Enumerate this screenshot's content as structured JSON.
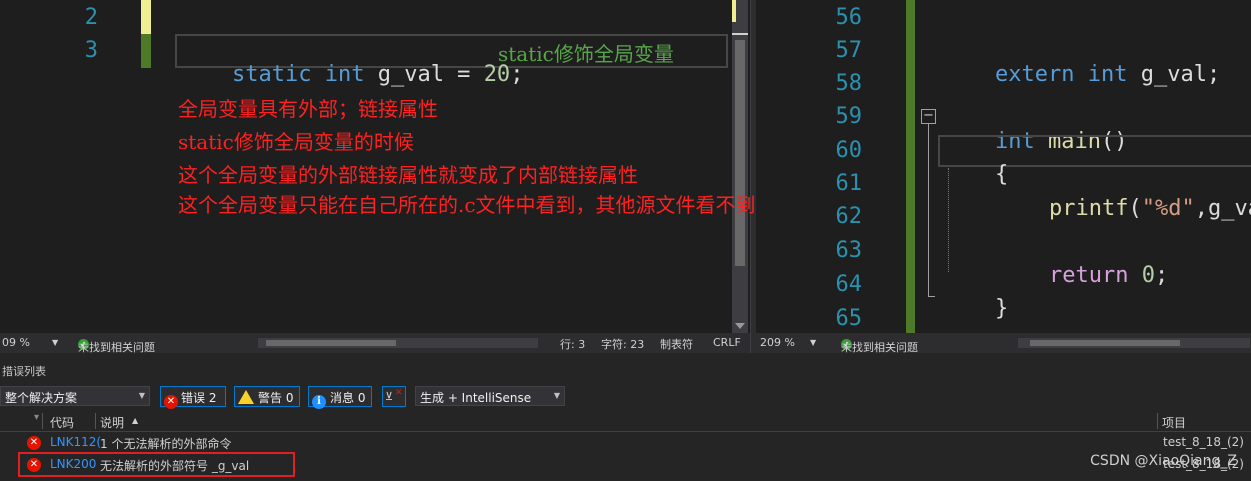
{
  "left_editor": {
    "line_numbers": [
      "2",
      "3"
    ],
    "code": {
      "static_kw": "static",
      "int_kw": "int",
      "ident": " g_val = ",
      "number": "20",
      "semi": ";",
      "comment": "static修饰全局变量"
    },
    "annotations": [
      "全局变量具有外部；链接属性",
      "static修饰全局变量的时候",
      "这个全局变量的外部链接属性就变成了内部链接属性",
      "这个全局变量只能在自己所在的.c文件中看到，其他源文件看不到"
    ]
  },
  "right_editor": {
    "line_numbers": [
      "56",
      "57",
      "58",
      "59",
      "60",
      "61",
      "62",
      "63",
      "64",
      "65"
    ],
    "code": {
      "extern_kw": "extern",
      "int_kw": "int",
      "extern_rest": " g_val;",
      "collapse_glyph": "−",
      "main_int": "int",
      "main_fn": " main",
      "main_parens": "()",
      "open_brace": "{",
      "printf_fn": "printf",
      "printf_open": "(",
      "printf_str": "\"%d\"",
      "printf_rest": ",g_val);",
      "return_kw": "return",
      "return_val": "0",
      "return_semi": ";",
      "close_brace": "}"
    }
  },
  "left_status": {
    "zoom": "09 %",
    "issues": "未找到相关问题",
    "line": "行: 3",
    "char": "字符: 23",
    "tab": "制表符",
    "eol": "CRLF"
  },
  "right_status": {
    "zoom": "209 %",
    "issues": "未找到相关问题"
  },
  "error_list": {
    "title": "措误列表",
    "scope": "整个解决方案",
    "errors_btn": "错误 2",
    "warnings_btn": "警告 0",
    "messages_btn": "消息 0",
    "build_filter": "生成 + IntelliSense",
    "col_code": "代码",
    "col_desc": "说明",
    "col_project": "项目",
    "rows": [
      {
        "code": "LNK112(",
        "desc": "1 个无法解析的外部命令",
        "project": "test_8_18_(2)"
      },
      {
        "code": "LNK200",
        "desc": "无法解析的外部符号 _g_val",
        "project": "test_8_18_(2)"
      }
    ]
  },
  "watermark": "CSDN @XiaoQiang_Z",
  "colors": {
    "accent": "#007acc",
    "annotation": "#ff2020",
    "error_red": "#e51400",
    "change_bar": "#4e7a27"
  }
}
